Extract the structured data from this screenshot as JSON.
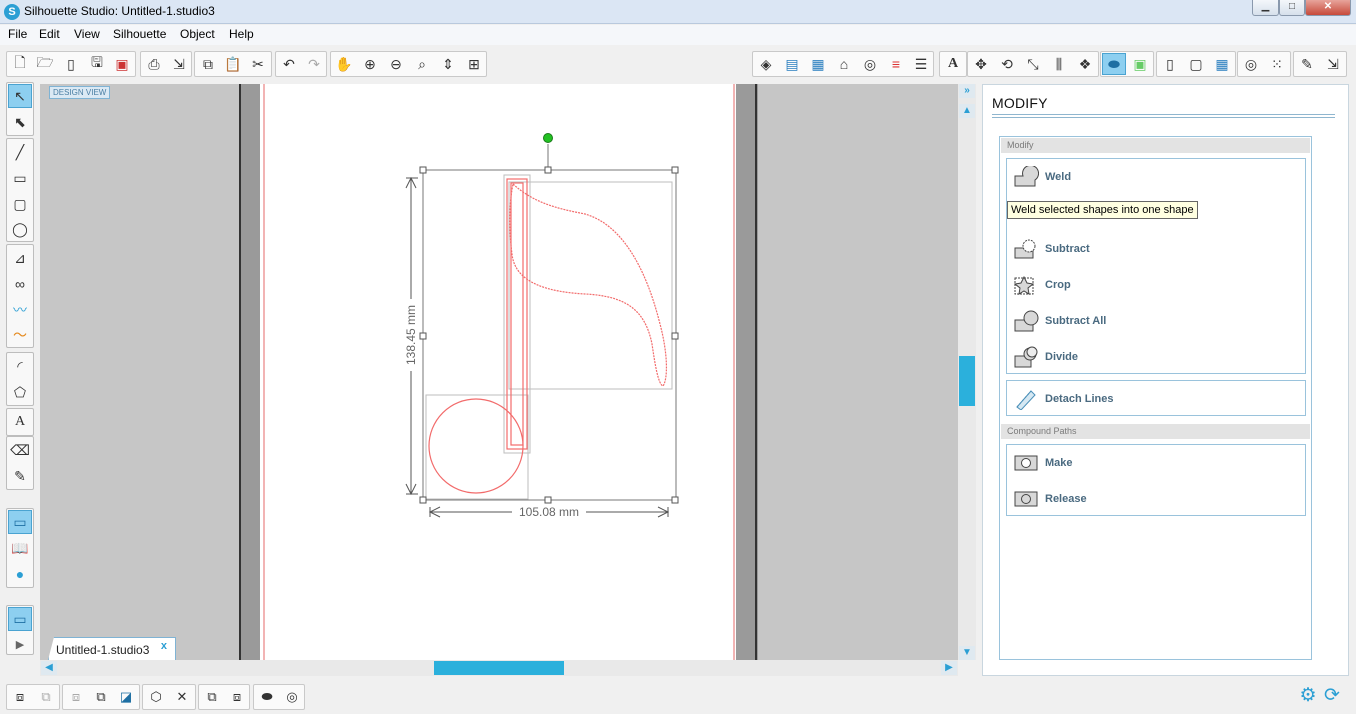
{
  "window": {
    "title": "Silhouette Studio: Untitled-1.studio3",
    "app_logo": "S",
    "controls": {
      "minimize": "▁",
      "maximize": "□",
      "close": "✕"
    }
  },
  "menu": [
    "File",
    "Edit",
    "View",
    "Silhouette",
    "Object",
    "Help"
  ],
  "toolbar": {
    "left_icons": [
      "new-file-icon",
      "open-file-icon",
      "open-library-icon",
      "save-icon",
      "save-to-library-icon",
      "print-icon",
      "send-to-silhouette-icon",
      "copy-icon",
      "paste-icon",
      "cut-icon",
      "undo-icon",
      "redo-icon",
      "pan-icon",
      "zoom-in-icon",
      "zoom-out-icon",
      "zoom-select-icon",
      "zoom-fit-icon",
      "fit-to-page-icon"
    ],
    "right_icons": [
      "fill-color-icon",
      "fill-gradient-icon",
      "fill-pattern-icon",
      "line-color-icon",
      "line-style-icon",
      "line-style-2-icon",
      "line-options-icon",
      "text-style-icon",
      "transform-icon",
      "rotate-icon",
      "scale-icon",
      "align-icon",
      "replicate-icon",
      "modify-icon",
      "offset-icon",
      "trace-icon",
      "page-setup-icon",
      "registration-marks-icon",
      "grid-icon",
      "cut-settings-icon",
      "pixscan-icon",
      "store-icon",
      "send-icon"
    ]
  },
  "left_tools": [
    "select-icon",
    "edit-points-icon",
    "line-icon",
    "rectangle-icon",
    "rounded-rectangle-icon",
    "ellipse-icon",
    "polygon-icon",
    "curve-icon",
    "freehand-icon",
    "smooth-freehand-icon",
    "arc-icon",
    "regular-polygon-icon",
    "text-icon",
    "eraser-icon",
    "knife-icon",
    "design-view-icon",
    "library-icon",
    "online-store-icon",
    "page-view-icon",
    "play-icon"
  ],
  "canvas": {
    "design_view_label": "DESIGN VIEW",
    "height_label": "138.45 mm",
    "width_label": "105.08 mm",
    "selection_color": "#f26b6b",
    "handle_rotate_color": "#22c122"
  },
  "doc_tab": {
    "name": "Untitled-1.studio3",
    "close": "x"
  },
  "modify_panel": {
    "title": "MODIFY",
    "section_modify": "Modify",
    "actions": {
      "weld": "Weld",
      "subtract": "Subtract",
      "crop": "Crop",
      "subtract_all": "Subtract All",
      "divide": "Divide",
      "detach_lines": "Detach Lines"
    },
    "section_compound": "Compound Paths",
    "compound_actions": {
      "make": "Make",
      "release": "Release"
    }
  },
  "tooltip": "Weld selected shapes into one shape",
  "bottom_icons": [
    "group-icon",
    "ungroup-icon",
    "make-compound-icon",
    "release-compound-icon",
    "bring-to-front-icon",
    "send-to-back-icon",
    "select-all-icon",
    "deselect-icon",
    "bring-forward-icon",
    "send-backward-icon",
    "weld-quick-icon",
    "offset-quick-icon"
  ],
  "accent": "#2bb0dc"
}
